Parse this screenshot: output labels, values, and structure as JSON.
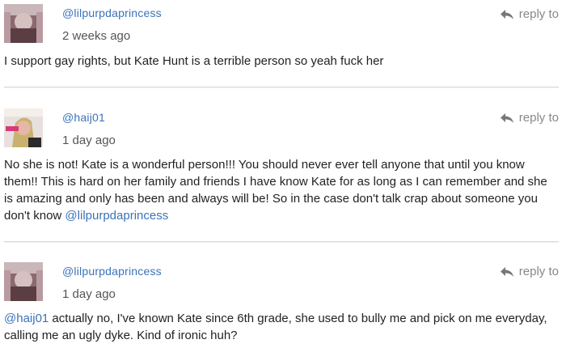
{
  "comments": [
    {
      "username": "@lilpurpdaprincess",
      "time": "2 weeks ago",
      "reply_label": "reply to",
      "text": "I support gay rights, but Kate Hunt is a terrible person so yeah fuck her"
    },
    {
      "username": "@haij01",
      "time": "1 day ago",
      "reply_label": "reply to",
      "text": "No she is not! Kate is a wonderful person!!! You should never ever tell anyone that until you know them!! This is hard on her family and friends I have know Kate for as long as I can remember and she is amazing and only has been and always will be! So in the case don't talk crap about someone you don't know ",
      "mention": "@lilpurpdaprincess"
    },
    {
      "username": "@lilpurpdaprincess",
      "time": "1 day ago",
      "reply_label": "reply to",
      "mention": "@haij01",
      "text": " actually no, I've known Kate since 6th grade, she used to bully me and pick on me everyday, calling me an ugly dyke. Kind of ironic huh?"
    }
  ],
  "icons": {
    "reply": "reply-arrow-icon"
  },
  "colors": {
    "link": "#3b73b9",
    "meta": "#888888",
    "text": "#222222",
    "divider": "#d9d9d9"
  }
}
